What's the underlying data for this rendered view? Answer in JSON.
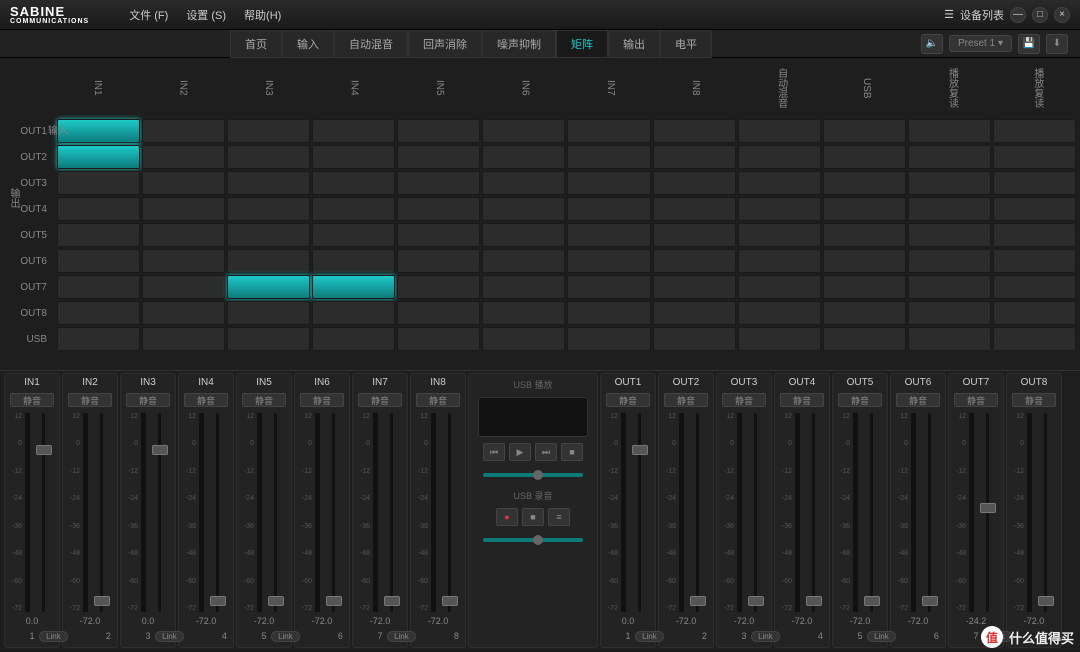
{
  "brand": {
    "name": "SABINE",
    "tagline": "COMMUNICATIONS"
  },
  "menu": {
    "file": "文件 (F)",
    "settings": "设置 (S)",
    "help": "帮助(H)"
  },
  "titlebar": {
    "deviceList": "设备列表"
  },
  "tabs": [
    "首页",
    "输入",
    "自动混音",
    "回声消除",
    "噪声抑制",
    "矩阵",
    "输出",
    "电平"
  ],
  "activeTab": 5,
  "preset": "Preset 1",
  "matrix": {
    "inputLabel": "输入",
    "outputLabel": "输出",
    "cols": [
      "IN1",
      "IN2",
      "IN3",
      "IN4",
      "IN5",
      "IN6",
      "IN7",
      "IN8",
      "自动混音",
      "USB",
      "播放复读",
      "播放复读"
    ],
    "rows": [
      "OUT1",
      "OUT2",
      "OUT3",
      "OUT4",
      "OUT5",
      "OUT6",
      "OUT7",
      "OUT8",
      "USB"
    ],
    "on": [
      [
        0,
        0
      ],
      [
        1,
        0
      ],
      [
        6,
        2
      ],
      [
        6,
        3
      ]
    ]
  },
  "muteLabel": "静音",
  "linkLabel": "Link",
  "scaleTicks": [
    "12",
    "0",
    "-12",
    "-24",
    "-36",
    "-48",
    "-60",
    "-72"
  ],
  "inputs": [
    {
      "name": "IN1",
      "value": "0.0",
      "index": "1",
      "faderPct": 16,
      "meterPct": 0
    },
    {
      "name": "IN2",
      "value": "-72.0",
      "index": "2",
      "faderPct": 92,
      "meterPct": 0
    },
    {
      "name": "IN3",
      "value": "0.0",
      "index": "3",
      "faderPct": 16,
      "meterPct": 0
    },
    {
      "name": "IN4",
      "value": "-72.0",
      "index": "4",
      "faderPct": 92,
      "meterPct": 0
    },
    {
      "name": "IN5",
      "value": "-72.0",
      "index": "5",
      "faderPct": 92,
      "meterPct": 0
    },
    {
      "name": "IN6",
      "value": "-72.0",
      "index": "6",
      "faderPct": 92,
      "meterPct": 0
    },
    {
      "name": "IN7",
      "value": "-72.0",
      "index": "7",
      "faderPct": 92,
      "meterPct": 0
    },
    {
      "name": "IN8",
      "value": "-72.0",
      "index": "8",
      "faderPct": 92,
      "meterPct": 0
    }
  ],
  "outputs": [
    {
      "name": "OUT1",
      "value": "0.0",
      "index": "1",
      "faderPct": 16,
      "meterPct": 0
    },
    {
      "name": "OUT2",
      "value": "-72.0",
      "index": "2",
      "faderPct": 92,
      "meterPct": 0
    },
    {
      "name": "OUT3",
      "value": "-72.0",
      "index": "3",
      "faderPct": 92,
      "meterPct": 0
    },
    {
      "name": "OUT4",
      "value": "-72.0",
      "index": "4",
      "faderPct": 92,
      "meterPct": 0
    },
    {
      "name": "OUT5",
      "value": "-72.0",
      "index": "5",
      "faderPct": 92,
      "meterPct": 0
    },
    {
      "name": "OUT6",
      "value": "-72.0",
      "index": "6",
      "faderPct": 92,
      "meterPct": 0
    },
    {
      "name": "OUT7",
      "value": "-24.2",
      "index": "7",
      "faderPct": 45,
      "meterPct": 0
    },
    {
      "name": "OUT8",
      "value": "-72.0",
      "index": "8",
      "faderPct": 92,
      "meterPct": 0
    }
  ],
  "usb": {
    "playLabel": "USB 播放",
    "recLabel": "USB 录音"
  },
  "watermark": "什么值得买"
}
